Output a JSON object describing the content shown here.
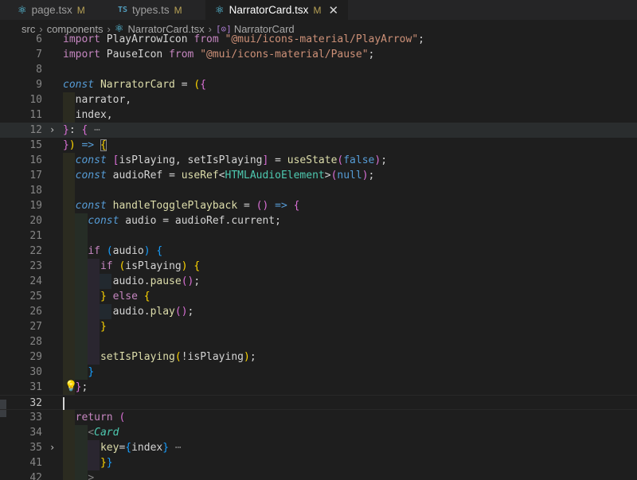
{
  "tabs": [
    {
      "name": "page.tsx",
      "status": "M",
      "icon": "react-icon"
    },
    {
      "name": "types.ts",
      "status": "M",
      "icon": "ts-icon",
      "icon_text": "TS"
    },
    {
      "name": "NarratorCard.tsx",
      "status": "M",
      "icon": "react-icon",
      "active": true
    }
  ],
  "breadcrumb": [
    "src",
    "components",
    "NarratorCard.tsx",
    "NarratorCard"
  ],
  "breadcrumb_symbol_glyph": "[⊙]",
  "lines": [
    {
      "n": "6",
      "text": "import PlayArrowIcon from \"@mui/icons-material/PlayArrow\";"
    },
    {
      "n": "7",
      "text": "import PauseIcon from \"@mui/icons-material/Pause\";"
    },
    {
      "n": "8",
      "text": ""
    },
    {
      "n": "9",
      "text": "const NarratorCard = ({"
    },
    {
      "n": "10",
      "text": "  narrator,"
    },
    {
      "n": "11",
      "text": "  index,"
    },
    {
      "n": "12",
      "text": "}: { ⋯",
      "folded": true
    },
    {
      "n": "15",
      "text": "}) => {"
    },
    {
      "n": "16",
      "text": "  const [isPlaying, setIsPlaying] = useState(false);"
    },
    {
      "n": "17",
      "text": "  const audioRef = useRef<HTMLAudioElement>(null);"
    },
    {
      "n": "18",
      "text": ""
    },
    {
      "n": "19",
      "text": "  const handleTogglePlayback = () => {"
    },
    {
      "n": "20",
      "text": "    const audio = audioRef.current;"
    },
    {
      "n": "21",
      "text": ""
    },
    {
      "n": "22",
      "text": "    if (audio) {"
    },
    {
      "n": "23",
      "text": "      if (isPlaying) {"
    },
    {
      "n": "24",
      "text": "        audio.pause();"
    },
    {
      "n": "25",
      "text": "      } else {"
    },
    {
      "n": "26",
      "text": "        audio.play();"
    },
    {
      "n": "27",
      "text": "      }"
    },
    {
      "n": "28",
      "text": ""
    },
    {
      "n": "29",
      "text": "      setIsPlaying(!isPlaying);"
    },
    {
      "n": "30",
      "text": "    }"
    },
    {
      "n": "31",
      "text": "  };"
    },
    {
      "n": "32",
      "text": "",
      "cursor": true
    },
    {
      "n": "33",
      "text": "  return ("
    },
    {
      "n": "34",
      "text": "    <Card"
    },
    {
      "n": "35",
      "text": "      key={index} ⋯",
      "folded": true
    },
    {
      "n": "41",
      "text": "      }}"
    },
    {
      "n": "42",
      "text": "    >"
    }
  ],
  "colors": {
    "keyword": "#c586c0",
    "string": "#ce9178",
    "storage": "#569cd6",
    "function": "#dcdcaa",
    "variable": "#9cdcfe",
    "type": "#4ec9b0",
    "bracket1": "#ffd700",
    "bracket2": "#da70d6",
    "bracket3": "#179fff",
    "modified": "#b7a155"
  }
}
